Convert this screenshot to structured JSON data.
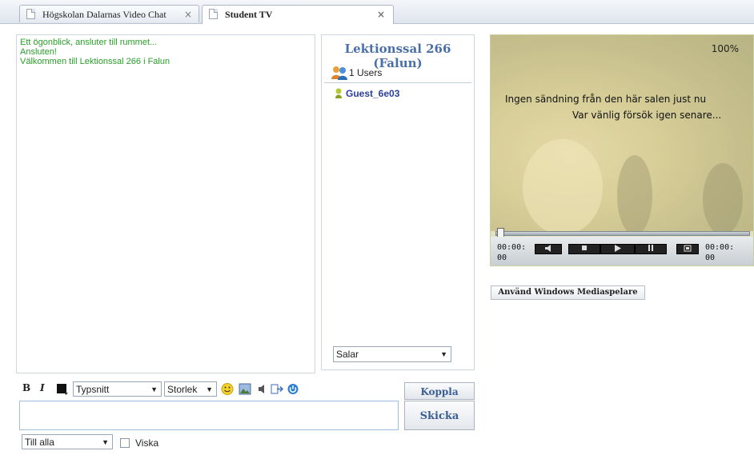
{
  "tabs": [
    {
      "label": "Högskolan Dalarnas Video Chat",
      "close": "×"
    },
    {
      "label": "Student TV",
      "close": "×"
    }
  ],
  "chat_log": [
    "Ett ögonblick, ansluter till rummet...",
    "Ansluten!",
    "Välkommen till Lektionssal 266 i Falun"
  ],
  "room": {
    "title": "Lektionssal 266 (Falun)",
    "users_count": "1 Users",
    "users": [
      "Guest_6e03"
    ],
    "rooms_select": "Salar"
  },
  "player": {
    "zoom": "100%",
    "message_line1": "Ingen sändning från den här salen just nu",
    "message_line2": "Var vänlig försök igen senare...",
    "time_elapsed": "00:00:00",
    "time_total": "00:00:00",
    "seek_fraction": 0.0,
    "use_wmp_label": "Använd Windows Mediaspelare"
  },
  "toolbar": {
    "bold": "B",
    "italic": "I",
    "font_select": "Typsnitt",
    "size_select": "Storlek"
  },
  "actions": {
    "disconnect": "Koppla ner",
    "send": "Skicka",
    "recipient_select": "Till alla",
    "whisper_label": "Viska"
  },
  "colors": {
    "system_message": "#2aa02a",
    "room_title": "#4a6fa8",
    "username": "#2a3f9e",
    "button_text": "#3a5f95"
  },
  "icons": [
    "document-icon",
    "close-icon",
    "users-icon",
    "user-icon",
    "text-color-icon",
    "smiley-icon",
    "image-icon",
    "sound-icon",
    "exit-icon",
    "power-icon",
    "dropdown-arrow-icon"
  ]
}
